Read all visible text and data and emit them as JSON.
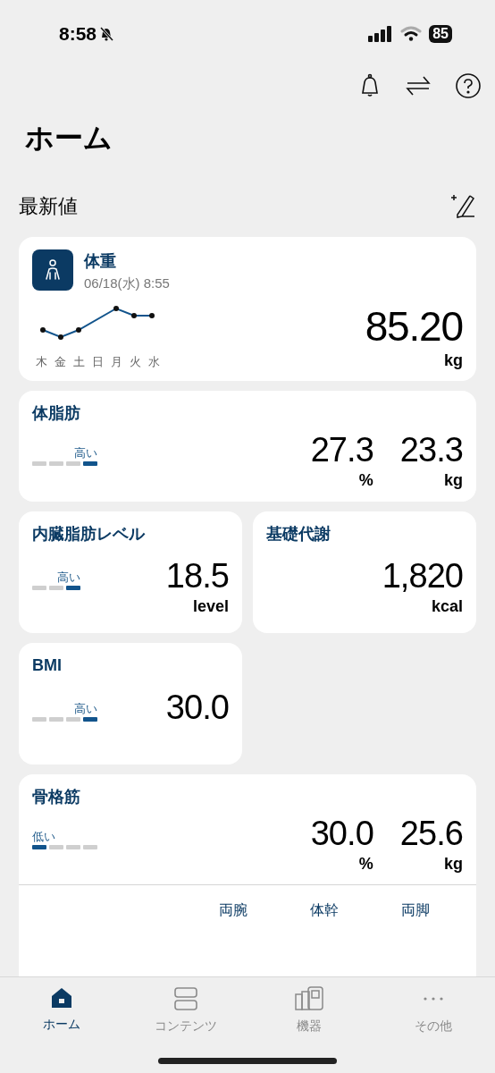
{
  "status_bar": {
    "time": "8:58",
    "battery": "85"
  },
  "header": {
    "title": "ホーム"
  },
  "section": {
    "title": "最新値"
  },
  "cards": [
    {
      "kind": "weight",
      "title": "体重",
      "date": "06/18(水) 8:55",
      "days": [
        "木",
        "金",
        "土",
        "日",
        "月",
        "火",
        "水"
      ],
      "value": "85.20",
      "unit": "kg"
    },
    {
      "kind": "wide",
      "title": "体脂肪",
      "rating": "高い",
      "segments": [
        false,
        false,
        false,
        true
      ],
      "values": [
        {
          "value": "27.3",
          "unit": "%"
        },
        {
          "value": "23.3",
          "unit": "kg"
        }
      ]
    },
    {
      "kind": "half",
      "title": "内臓脂肪レベル",
      "rating": "高い",
      "segments": [
        false,
        false,
        true
      ],
      "values": [
        {
          "value": "18.5",
          "unit": "level"
        }
      ]
    },
    {
      "kind": "half",
      "title": "基礎代謝",
      "values": [
        {
          "value": "1,820",
          "unit": "kcal"
        }
      ]
    },
    {
      "kind": "half",
      "title": "BMI",
      "rating": "高い",
      "segments": [
        false,
        false,
        false,
        true
      ],
      "values": [
        {
          "value": "30.0"
        }
      ]
    },
    {
      "kind": "wide",
      "title": "骨格筋",
      "rating": "低い",
      "segments": [
        true,
        false,
        false,
        false
      ],
      "values": [
        {
          "value": "30.0",
          "unit": "%"
        },
        {
          "value": "25.6",
          "unit": "kg"
        }
      ],
      "parts": [
        "両腕",
        "体幹",
        "両脚"
      ]
    }
  ],
  "tabs": [
    {
      "label": "ホーム",
      "kind": "home",
      "selected": true
    },
    {
      "label": "コンテンツ",
      "kind": "contents",
      "selected": false
    },
    {
      "label": "機器",
      "kind": "devices",
      "selected": false
    },
    {
      "label": "その他",
      "kind": "more",
      "selected": false
    }
  ]
}
